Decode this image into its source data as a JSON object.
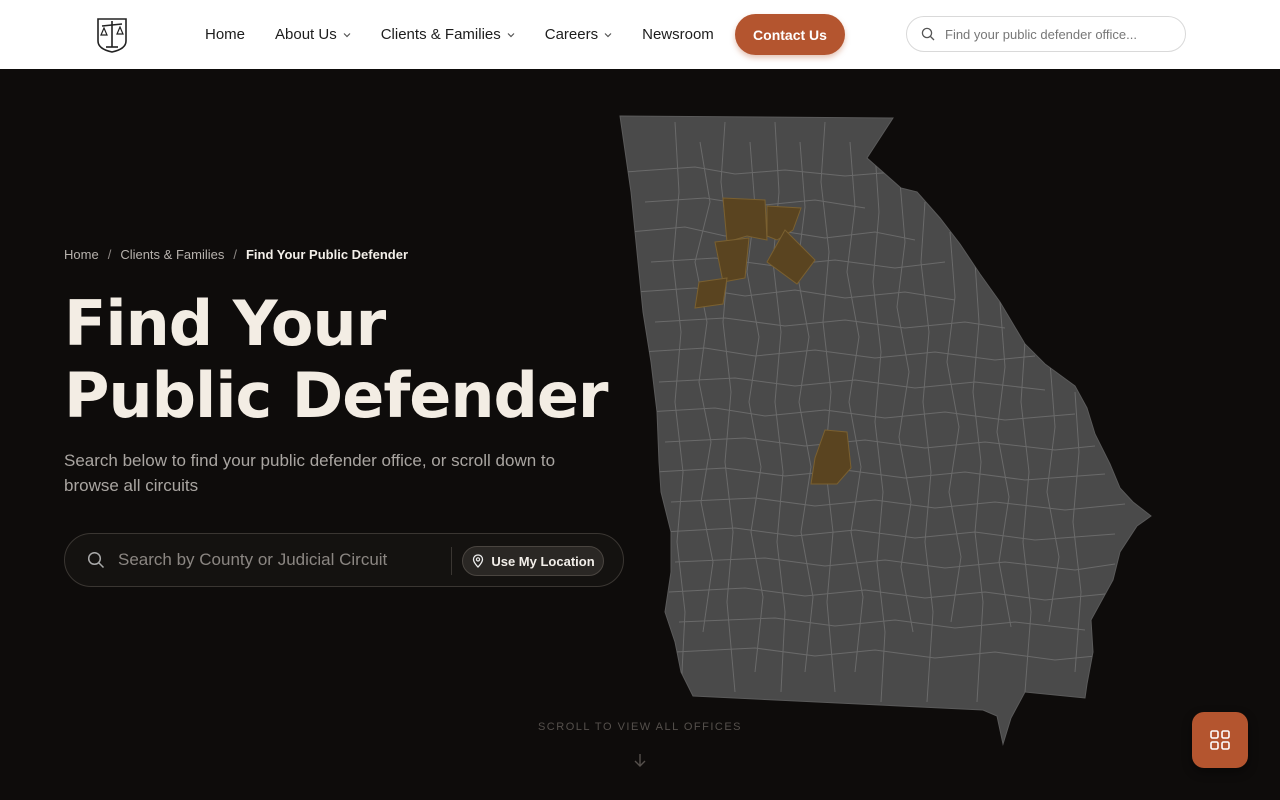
{
  "header": {
    "nav": [
      {
        "label": "Home",
        "has_dropdown": false
      },
      {
        "label": "About Us",
        "has_dropdown": true
      },
      {
        "label": "Clients & Families",
        "has_dropdown": true
      },
      {
        "label": "Careers",
        "has_dropdown": true
      },
      {
        "label": "Newsroom",
        "has_dropdown": false
      }
    ],
    "contact_label": "Contact Us",
    "search_placeholder": "Find your public defender office..."
  },
  "breadcrumb": {
    "home": "Home",
    "section": "Clients & Families",
    "current": "Find Your Public Defender"
  },
  "hero": {
    "title_line1": "Find Your",
    "title_line2": "Public Defender",
    "subtitle": "Search below to find your public defender office, or scroll down to browse all circuits",
    "search_placeholder": "Search by County or Judicial Circuit",
    "location_label": "Use My Location"
  },
  "scroll_hint": "SCROLL TO VIEW ALL OFFICES",
  "icons": {
    "logo": "scales-logo-icon",
    "header_search": "search-icon",
    "hero_search": "search-icon",
    "location": "map-pin-icon",
    "scroll": "arrow-down-icon",
    "fab": "grid-icon"
  },
  "colors": {
    "accent": "#b4552f",
    "background": "#0e0c0b",
    "map_fill": "#4a4a4a",
    "map_highlight": "#5a4420"
  }
}
